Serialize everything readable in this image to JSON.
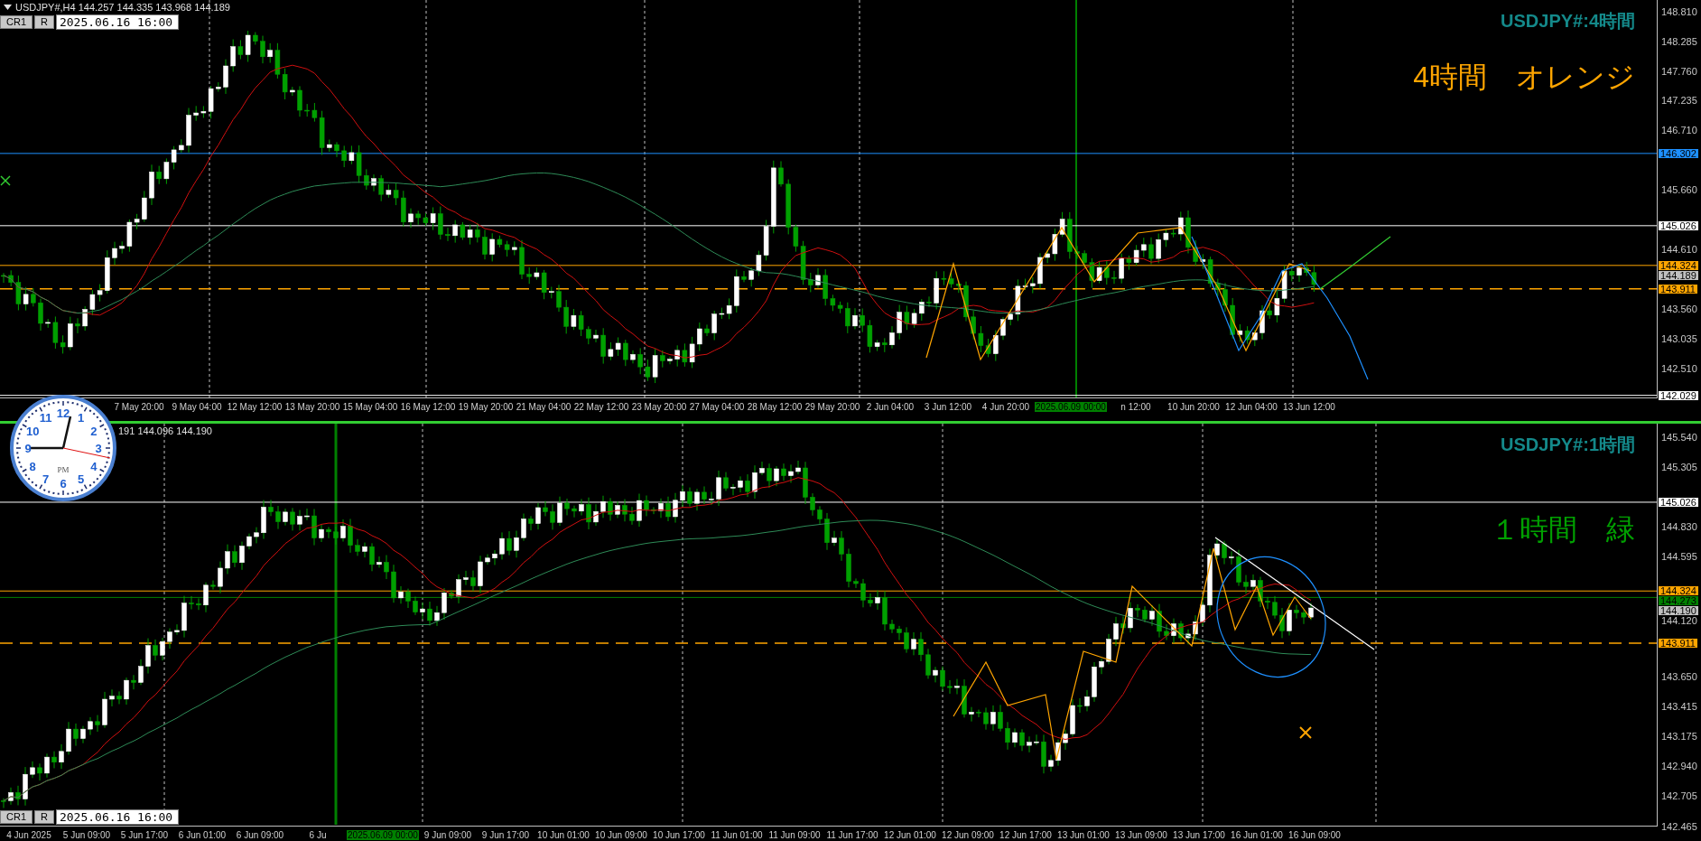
{
  "panes": [
    {
      "header": "USDJPY#,H4 144.257 144.335 143.968 144.189",
      "buttons": [
        "CR1",
        "R"
      ],
      "date": "2025.06.16 16:00",
      "title": "USDJPY#:4時間",
      "note": {
        "text": "4時間　オレンジ",
        "color": "#ffa500"
      },
      "price_axis": {
        "ticks": [
          "148.810",
          "148.285",
          "147.760",
          "147.235",
          "146.710",
          "145.660",
          "144.610",
          "143.560",
          "143.035",
          "142.510"
        ],
        "tags": [
          {
            "text": "146.302",
            "color": "#1e90ff",
            "kind": "solid"
          },
          {
            "text": "145.026",
            "color": "#ffffff",
            "kind": "solid"
          },
          {
            "text": "144.324",
            "color": "#ffa500",
            "kind": "solid"
          },
          {
            "text": "144.189",
            "color": "#c0c0c0",
            "kind": "none"
          },
          {
            "text": "143.911",
            "color": "#ffa500",
            "kind": "dashed"
          },
          {
            "text": "142.029",
            "color": "#ffffff",
            "kind": "solid"
          }
        ]
      },
      "time_axis": [
        {
          "text": "7 May 20:00",
          "kind": "tick"
        },
        {
          "text": "9 May 04:00",
          "kind": "tick"
        },
        {
          "text": "12 May 12:00",
          "kind": "tick"
        },
        {
          "text": "13 May 20:00",
          "kind": "tick"
        },
        {
          "text": "15 May 04:00",
          "kind": "tick"
        },
        {
          "text": "16 May 12:00",
          "kind": "tick"
        },
        {
          "text": "19 May 20:00",
          "kind": "tick"
        },
        {
          "text": "21 May 04:00",
          "kind": "tick"
        },
        {
          "text": "22 May 12:00",
          "kind": "tick"
        },
        {
          "text": "23 May 20:00",
          "kind": "tick"
        },
        {
          "text": "27 May 04:00",
          "kind": "tick"
        },
        {
          "text": "28 May 12:00",
          "kind": "tick"
        },
        {
          "text": "29 May 20:00",
          "kind": "tick"
        },
        {
          "text": "2 Jun 04:00",
          "kind": "tick"
        },
        {
          "text": "3 Jun 12:00",
          "kind": "tick"
        },
        {
          "text": "4 Jun 20:00",
          "kind": "tick"
        },
        {
          "text": "2025.06.09 00:00",
          "kind": "cursor"
        },
        {
          "text": "n 12:00",
          "kind": "tick"
        },
        {
          "text": "10 Jun 20:00",
          "kind": "tick"
        },
        {
          "text": "12 Jun 04:00",
          "kind": "tick"
        },
        {
          "text": "13 Jun 12:00",
          "kind": "tick"
        }
      ]
    },
    {
      "header": "191 144.096 144.190",
      "buttons": [
        "CR1",
        "R"
      ],
      "date": "2025.06.16 16:00",
      "title": "USDJPY#:1時間",
      "note": {
        "text": "１時間　緑",
        "color": "#00a000"
      },
      "price_axis": {
        "ticks": [
          "145.540",
          "145.305",
          "144.830",
          "144.595",
          "144.120",
          "143.650",
          "143.415",
          "143.175",
          "142.940",
          "142.705",
          "142.465"
        ],
        "tags": [
          {
            "text": "145.026",
            "color": "#ffffff",
            "kind": "solid"
          },
          {
            "text": "144.324",
            "color": "#ffa500",
            "kind": "solid"
          },
          {
            "text": "144.273",
            "color": "#008000",
            "kind": "solid"
          },
          {
            "text": "144.190",
            "color": "#c0c0c0",
            "kind": "none"
          },
          {
            "text": "143.911",
            "color": "#ffa500",
            "kind": "dashed"
          }
        ]
      },
      "time_axis": [
        {
          "text": "4 Jun 2025",
          "kind": "tick"
        },
        {
          "text": "5 Jun 09:00",
          "kind": "tick"
        },
        {
          "text": "5 Jun 17:00",
          "kind": "tick"
        },
        {
          "text": "6 Jun 01:00",
          "kind": "tick"
        },
        {
          "text": "6 Jun 09:00",
          "kind": "tick"
        },
        {
          "text": "6 Ju",
          "kind": "tick"
        },
        {
          "text": "2025.06.09 00:00",
          "kind": "cursor"
        },
        {
          "text": "9 Jun 09:00",
          "kind": "tick"
        },
        {
          "text": "9 Jun 17:00",
          "kind": "tick"
        },
        {
          "text": "10 Jun 01:00",
          "kind": "tick"
        },
        {
          "text": "10 Jun 09:00",
          "kind": "tick"
        },
        {
          "text": "10 Jun 17:00",
          "kind": "tick"
        },
        {
          "text": "11 Jun 01:00",
          "kind": "tick"
        },
        {
          "text": "11 Jun 09:00",
          "kind": "tick"
        },
        {
          "text": "11 Jun 17:00",
          "kind": "tick"
        },
        {
          "text": "12 Jun 01:00",
          "kind": "tick"
        },
        {
          "text": "12 Jun 09:00",
          "kind": "tick"
        },
        {
          "text": "12 Jun 17:00",
          "kind": "tick"
        },
        {
          "text": "13 Jun 01:00",
          "kind": "tick"
        },
        {
          "text": "13 Jun 09:00",
          "kind": "tick"
        },
        {
          "text": "13 Jun 17:00",
          "kind": "tick"
        },
        {
          "text": "16 Jun 01:00",
          "kind": "tick"
        },
        {
          "text": "16 Jun 09:00",
          "kind": "tick"
        }
      ]
    }
  ],
  "clock": {
    "numerals": [
      "12",
      "11",
      "1",
      "10",
      "2",
      "9",
      "3",
      "8",
      "4",
      "7",
      "5",
      "6"
    ],
    "period": "PM"
  }
}
